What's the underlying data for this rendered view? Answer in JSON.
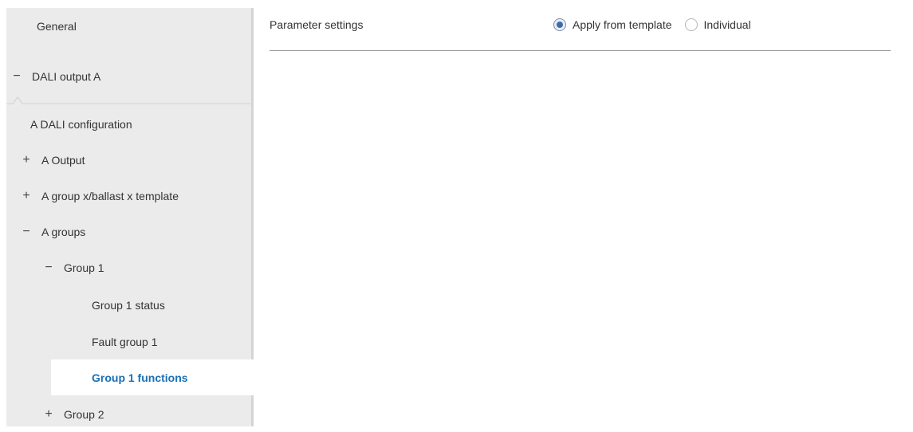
{
  "sidebar": {
    "items": [
      {
        "label": "General",
        "sign": ""
      },
      {
        "label": "DALI output A",
        "sign": "−"
      },
      {
        "label": "A DALI configuration",
        "sign": ""
      },
      {
        "label": "A Output",
        "sign": "+"
      },
      {
        "label": "A group x/ballast x template",
        "sign": "+"
      },
      {
        "label": "A groups",
        "sign": "−"
      },
      {
        "label": "Group 1",
        "sign": "−"
      },
      {
        "label": "Group 1 status",
        "sign": ""
      },
      {
        "label": "Fault group 1",
        "sign": ""
      },
      {
        "label": "Group 1 functions",
        "sign": ""
      },
      {
        "label": "Group 2",
        "sign": "+"
      }
    ]
  },
  "main": {
    "parameter_label": "Parameter settings",
    "options": [
      {
        "label": "Apply from template",
        "checked": true
      },
      {
        "label": "Individual",
        "checked": false
      }
    ]
  },
  "colors": {
    "sidebar_bg": "#ebebeb",
    "selected_text": "#1a6fb5",
    "radio_checked": "#3d6ba8"
  }
}
